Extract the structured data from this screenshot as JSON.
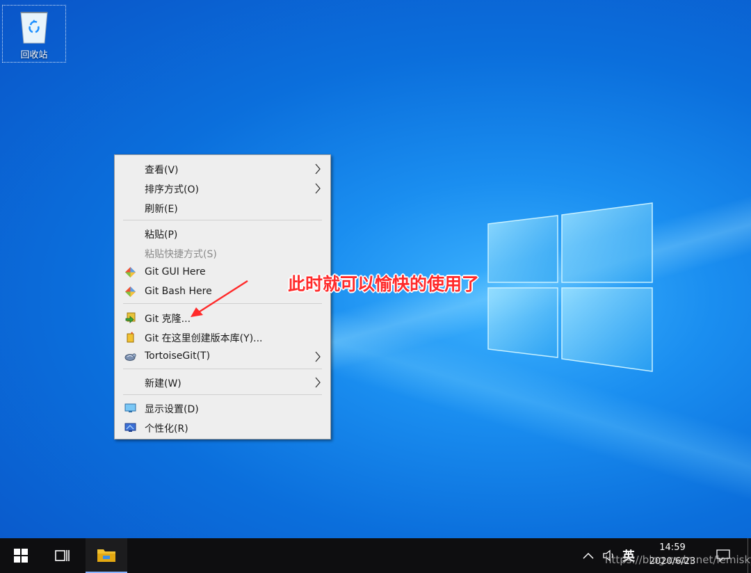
{
  "desktop": {
    "recycle_bin_label": "回收站"
  },
  "context_menu": {
    "items": [
      {
        "label": "查看(V)",
        "has_submenu": true,
        "icon": null,
        "disabled": false
      },
      {
        "label": "排序方式(O)",
        "has_submenu": true,
        "icon": null,
        "disabled": false
      },
      {
        "label": "刷新(E)",
        "has_submenu": false,
        "icon": null,
        "disabled": false
      },
      {
        "label": "粘贴(P)",
        "has_submenu": false,
        "icon": null,
        "disabled": false
      },
      {
        "label": "粘贴快捷方式(S)",
        "has_submenu": false,
        "icon": null,
        "disabled": true
      },
      {
        "label": "Git GUI Here",
        "has_submenu": false,
        "icon": "git-gui-icon",
        "disabled": false
      },
      {
        "label": "Git Bash Here",
        "has_submenu": false,
        "icon": "git-bash-icon",
        "disabled": false
      },
      {
        "label": "Git 克隆...",
        "has_submenu": false,
        "icon": "git-clone-icon",
        "disabled": false
      },
      {
        "label": "Git 在这里创建版本库(Y)...",
        "has_submenu": false,
        "icon": "git-create-repo-icon",
        "disabled": false
      },
      {
        "label": "TortoiseGit(T)",
        "has_submenu": true,
        "icon": "tortoisegit-icon",
        "disabled": false
      },
      {
        "label": "新建(W)",
        "has_submenu": true,
        "icon": null,
        "disabled": false
      },
      {
        "label": "显示设置(D)",
        "has_submenu": false,
        "icon": "display-settings-icon",
        "disabled": false
      },
      {
        "label": "个性化(R)",
        "has_submenu": false,
        "icon": "personalize-icon",
        "disabled": false
      }
    ]
  },
  "annotation": {
    "text": "此时就可以愉快的使用了",
    "color": "#ff2a2a"
  },
  "taskbar": {
    "ime_indicator": "英",
    "time": "14:59",
    "date": "2020/6/23",
    "watermark": "https://blog.csdn.net/lemisky"
  },
  "colors": {
    "wallpaper_blue": "#0b6fdc",
    "taskbar": "#0e0e10",
    "menu_bg": "#eeeeee"
  }
}
